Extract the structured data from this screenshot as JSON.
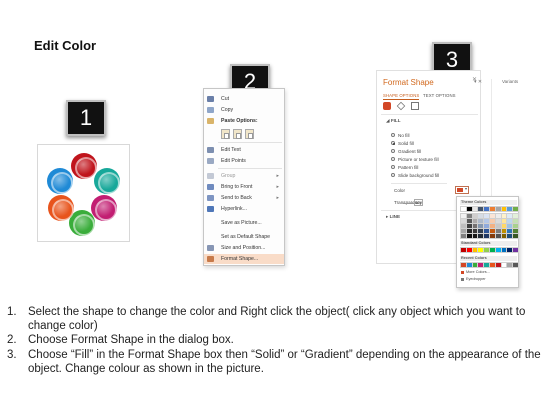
{
  "title": "Edit Color",
  "badges": [
    "1",
    "2",
    "3"
  ],
  "shapes": {
    "colors": {
      "top": "#c0141c",
      "upper_right": "#17a89a",
      "lower_right": "#c21e72",
      "bottom": "#3aad3b",
      "lower_left": "#e8541c",
      "upper_left": "#1f8ad6"
    }
  },
  "context_menu": {
    "items": [
      {
        "label": "Cut",
        "icon": "scissors-icon"
      },
      {
        "label": "Copy",
        "icon": "copy-icon"
      },
      {
        "label": "Paste Options:",
        "icon": "clipboard-icon"
      },
      {
        "label": "Edit Text",
        "icon": "edit-text-icon"
      },
      {
        "label": "Edit Points",
        "icon": "edit-points-icon"
      },
      {
        "label": "Group",
        "icon": "group-icon",
        "submenu": true
      },
      {
        "label": "Bring to Front",
        "icon": "bring-front-icon",
        "submenu": true
      },
      {
        "label": "Send to Back",
        "icon": "send-back-icon",
        "submenu": true
      },
      {
        "label": "Hyperlink...",
        "icon": "hyperlink-icon"
      },
      {
        "label": "Save as Picture...",
        "icon": ""
      },
      {
        "label": "Set as Default Shape",
        "icon": ""
      },
      {
        "label": "Size and Position...",
        "icon": "size-position-icon"
      },
      {
        "label": "Format Shape...",
        "icon": "format-shape-icon",
        "highlighted": true
      }
    ]
  },
  "format_pane": {
    "title": "Format Shape",
    "tabs": [
      "SHAPE OPTIONS",
      "TEXT OPTIONS"
    ],
    "fill_section": "FILL",
    "fill_options": [
      {
        "label": "No fill",
        "selected": false
      },
      {
        "label": "Solid fill",
        "selected": true
      },
      {
        "label": "Gradient fill",
        "selected": false
      },
      {
        "label": "Picture or texture fill",
        "selected": false
      },
      {
        "label": "Pattern fill",
        "selected": false
      },
      {
        "label": "Slide background fill",
        "selected": false
      }
    ],
    "color_label": "Color",
    "transparency_label": "Transparency",
    "transparency_value": "0%",
    "line_section": "LINE",
    "variants_label": "Variants",
    "accent_color": "#d24726"
  },
  "palette": {
    "theme_label": "Theme Colors",
    "theme_rows": [
      [
        "#ffffff",
        "#000000",
        "#e7e6e6",
        "#44546a",
        "#4472c4",
        "#ed7d31",
        "#a5a5a5",
        "#ffc000",
        "#5b9bd5",
        "#70ad47"
      ],
      [
        "#f2f2f2",
        "#7f7f7f",
        "#d0cece",
        "#d6dce4",
        "#dae3f3",
        "#fbe5d6",
        "#ededed",
        "#fff2cc",
        "#deebf7",
        "#e2f0d9"
      ],
      [
        "#d9d9d9",
        "#595959",
        "#aeabab",
        "#adb9ca",
        "#b4c7e7",
        "#f8cbad",
        "#dbdbdb",
        "#ffe699",
        "#bdd7ee",
        "#c5e0b4"
      ],
      [
        "#bfbfbf",
        "#404040",
        "#757171",
        "#8497b0",
        "#8faadc",
        "#f4b183",
        "#c9c9c9",
        "#ffd966",
        "#9dc3e6",
        "#a9d18e"
      ],
      [
        "#a6a6a6",
        "#262626",
        "#3a3838",
        "#333f50",
        "#2f5597",
        "#c55a11",
        "#7b7b7b",
        "#bf9000",
        "#2e75b6",
        "#548235"
      ],
      [
        "#7f7f7f",
        "#0d0d0d",
        "#171616",
        "#222a35",
        "#203864",
        "#843c0c",
        "#525252",
        "#7f6000",
        "#1f4e79",
        "#385723"
      ]
    ],
    "standard_label": "Standard Colors",
    "standard_row": [
      "#c00000",
      "#ff0000",
      "#ffc000",
      "#ffff00",
      "#92d050",
      "#00b050",
      "#00b0f0",
      "#0070c0",
      "#002060",
      "#7030a0"
    ],
    "recent_label": "Recent Colors",
    "recent_row": [
      "#d24726",
      "#1f8ad6",
      "#3aad3b",
      "#c21e72",
      "#17a89a",
      "#e8541c",
      "#c0141c",
      "#ffffff",
      "#a6a6a6",
      "#595959"
    ],
    "more_colors": "More Colors...",
    "eyedropper": "Eyedropper"
  },
  "instructions": [
    {
      "num": "1.",
      "text": "Select the shape to change the color and Right click the object( click any object which you want to change color)"
    },
    {
      "num": "2.",
      "text": "Choose Format Shape in the dialog box."
    },
    {
      "num": "3.",
      "text": "Choose “Fill” in the Format Shape box then “Solid” or “Gradient” depending on the appearance of the object. Change colour as shown in the picture."
    }
  ]
}
